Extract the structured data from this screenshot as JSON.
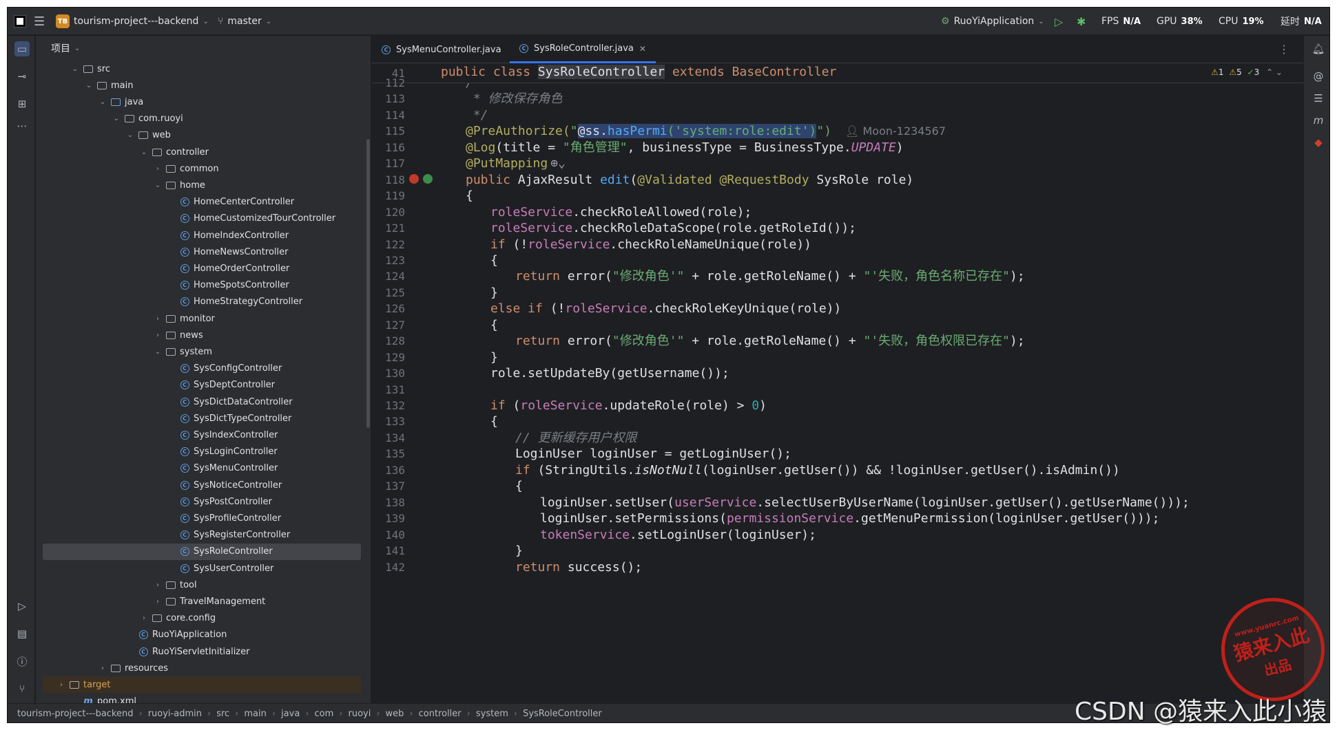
{
  "titlebar": {
    "project_badge": "TB",
    "project": "tourism-project---backend",
    "branch": "master",
    "run_config": "RuoYiApplication",
    "fps_label": "FPS",
    "fps_value": "N/A",
    "gpu_label": "GPU",
    "gpu_value": "38%",
    "cpu_label": "CPU",
    "cpu_value": "19%",
    "time_label": "延时",
    "time_value": "N/A"
  },
  "project_panel": {
    "title": "项目"
  },
  "tree": [
    {
      "label": "src",
      "depth": 3,
      "arrow": "open",
      "icon": "folder"
    },
    {
      "label": "main",
      "depth": 4,
      "arrow": "open",
      "icon": "folder"
    },
    {
      "label": "java",
      "depth": 5,
      "arrow": "open",
      "icon": "folder-blue"
    },
    {
      "label": "com.ruoyi",
      "depth": 6,
      "arrow": "open",
      "icon": "package"
    },
    {
      "label": "web",
      "depth": 7,
      "arrow": "open",
      "icon": "package"
    },
    {
      "label": "controller",
      "depth": 8,
      "arrow": "open",
      "icon": "package"
    },
    {
      "label": "common",
      "depth": 9,
      "arrow": "closed",
      "icon": "package"
    },
    {
      "label": "home",
      "depth": 9,
      "arrow": "open",
      "icon": "package"
    },
    {
      "label": "HomeCenterController",
      "depth": 10,
      "arrow": "",
      "icon": "class"
    },
    {
      "label": "HomeCustomizedTourController",
      "depth": 10,
      "arrow": "",
      "icon": "class"
    },
    {
      "label": "HomeIndexController",
      "depth": 10,
      "arrow": "",
      "icon": "class"
    },
    {
      "label": "HomeNewsController",
      "depth": 10,
      "arrow": "",
      "icon": "class"
    },
    {
      "label": "HomeOrderController",
      "depth": 10,
      "arrow": "",
      "icon": "class"
    },
    {
      "label": "HomeSpotsController",
      "depth": 10,
      "arrow": "",
      "icon": "class"
    },
    {
      "label": "HomeStrategyController",
      "depth": 10,
      "arrow": "",
      "icon": "class"
    },
    {
      "label": "monitor",
      "depth": 9,
      "arrow": "closed",
      "icon": "package"
    },
    {
      "label": "news",
      "depth": 9,
      "arrow": "closed",
      "icon": "package"
    },
    {
      "label": "system",
      "depth": 9,
      "arrow": "open",
      "icon": "package"
    },
    {
      "label": "SysConfigController",
      "depth": 10,
      "arrow": "",
      "icon": "class"
    },
    {
      "label": "SysDeptController",
      "depth": 10,
      "arrow": "",
      "icon": "class"
    },
    {
      "label": "SysDictDataController",
      "depth": 10,
      "arrow": "",
      "icon": "class"
    },
    {
      "label": "SysDictTypeController",
      "depth": 10,
      "arrow": "",
      "icon": "class"
    },
    {
      "label": "SysIndexController",
      "depth": 10,
      "arrow": "",
      "icon": "class"
    },
    {
      "label": "SysLoginController",
      "depth": 10,
      "arrow": "",
      "icon": "class"
    },
    {
      "label": "SysMenuController",
      "depth": 10,
      "arrow": "",
      "icon": "class"
    },
    {
      "label": "SysNoticeController",
      "depth": 10,
      "arrow": "",
      "icon": "class"
    },
    {
      "label": "SysPostController",
      "depth": 10,
      "arrow": "",
      "icon": "class"
    },
    {
      "label": "SysProfileController",
      "depth": 10,
      "arrow": "",
      "icon": "class"
    },
    {
      "label": "SysRegisterController",
      "depth": 10,
      "arrow": "",
      "icon": "class"
    },
    {
      "label": "SysRoleController",
      "depth": 10,
      "arrow": "",
      "icon": "class",
      "selected": true
    },
    {
      "label": "SysUserController",
      "depth": 10,
      "arrow": "",
      "icon": "class"
    },
    {
      "label": "tool",
      "depth": 9,
      "arrow": "closed",
      "icon": "package"
    },
    {
      "label": "TravelManagement",
      "depth": 9,
      "arrow": "closed",
      "icon": "package"
    },
    {
      "label": "core.config",
      "depth": 8,
      "arrow": "closed",
      "icon": "package"
    },
    {
      "label": "RuoYiApplication",
      "depth": 7,
      "arrow": "",
      "icon": "class"
    },
    {
      "label": "RuoYiServletInitializer",
      "depth": 7,
      "arrow": "",
      "icon": "class"
    },
    {
      "label": "resources",
      "depth": 5,
      "arrow": "closed",
      "icon": "folder"
    },
    {
      "label": "target",
      "depth": 2,
      "arrow": "closed",
      "icon": "folder"
    },
    {
      "label": "pom.xml",
      "depth": 3,
      "arrow": "",
      "icon": "maven"
    }
  ],
  "tabs": [
    {
      "label": "SysMenuController.java"
    },
    {
      "label": "SysRoleController.java",
      "active": true
    }
  ],
  "sticky": {
    "line": "41",
    "text_pre": "public class ",
    "text_cls": "SysRoleController",
    "text_ext": " extends BaseController"
  },
  "inspections": {
    "warn": "1",
    "weak": "5",
    "ok": "3"
  },
  "author": "Moon-1234567",
  "line_numbers": [
    "112",
    "113",
    "114",
    "115",
    "116",
    "117",
    "118",
    "119",
    "120",
    "121",
    "122",
    "123",
    "124",
    "125",
    "126",
    "127",
    "128",
    "129",
    "130",
    "131",
    "132",
    "133",
    "134",
    "135",
    "136",
    "137",
    "138",
    "139",
    "140",
    "141",
    "142"
  ],
  "code": {
    "l112": "/**",
    "l113": " * 修改保存角色",
    "l114": " */",
    "l115a": "@PreAuthorize(",
    "l115b": "\"",
    "l115c": "@ss.",
    "l115d": "hasPermi",
    "l115e": "('system:role:edit')",
    "l115f": "\")",
    "l116a": "@Log",
    "l116b": "(title = ",
    "l116c": "\"角色管理\"",
    "l116d": ", businessType = BusinessType.",
    "l116e": "UPDATE",
    "l116f": ")",
    "l117": "@PutMapping",
    "l118a": "public ",
    "l118b": "AjaxResult ",
    "l118c": "edit",
    "l118d": "(",
    "l118e": "@Validated @RequestBody ",
    "l118f": "SysRole role)",
    "l119": "{",
    "l120a": "roleService",
    ".l120b": "",
    "l120b": ".checkRoleAllowed(role);",
    "l121a": "roleService",
    "l121b": ".checkRoleDataScope(role.getRoleId());",
    "l122a": "if ",
    "l122b": "(!",
    "l122c": "roleService",
    "l122d": ".checkRoleNameUnique(role))",
    "l123": "{",
    "l124a": "return ",
    "l124b": "error(",
    "l124c": "\"修改角色'\"",
    "l124d": " + role.getRoleName() + ",
    "l124e": "\"'失败，角色名称已存在\"",
    "l124f": ");",
    "l125": "}",
    "l126a": "else if ",
    "l126b": "(!",
    "l126c": "roleService",
    "l126d": ".checkRoleKeyUnique(role))",
    "l127": "{",
    "l128a": "return ",
    "l128b": "error(",
    "l128c": "\"修改角色'\"",
    "l128d": " + role.getRoleName() + ",
    "l128e": "\"'失败，角色权限已存在\"",
    "l128f": ");",
    "l129": "}",
    "l130": "role.setUpdateBy(getUsername());",
    "l132a": "if ",
    "l132b": "(",
    "l132c": "roleService",
    "l132d": ".updateRole(role) > ",
    "l132e": "0",
    "l132f": ")",
    "l133": "{",
    "l134": "// 更新缓存用户权限",
    "l135": "LoginUser loginUser = getLoginUser();",
    "l136a": "if ",
    "l136b": "(StringUtils.",
    "l136c": "isNotNull",
    "l136d": "(loginUser.getUser()) && !loginUser.getUser().isAdmin())",
    "l137": "{",
    "l138a": "loginUser.setUser(",
    "l138b": "userService",
    "l138c": ".selectUserByUserName(loginUser.getUser().getUserName()));",
    "l139a": "loginUser.setPermissions(",
    "l139b": "permissionService",
    "l139c": ".getMenuPermission(loginUser.getUser()));",
    "l140a": "tokenService",
    "l140b": ".setLoginUser(loginUser);",
    "l141": "}",
    "l142a": "return ",
    "l142b": "success();"
  },
  "breadcrumb": [
    "tourism-project---backend",
    "ruoyi-admin",
    "src",
    "main",
    "java",
    "com",
    "ruoyi",
    "web",
    "controller",
    "system",
    "SysRoleController"
  ],
  "stamp": {
    "line1": "猿来入此",
    "line2": "出品",
    "url": "www.yuanrc.com"
  },
  "watermark": "CSDN @猿来入此小猿",
  "colors": {
    "bg": "#1e1f22",
    "panel": "#2b2d30",
    "keyword": "#cf8e6d",
    "string": "#6aab73",
    "annotation": "#b3ae60",
    "field": "#c77dbb",
    "accent": "#3574f0"
  }
}
